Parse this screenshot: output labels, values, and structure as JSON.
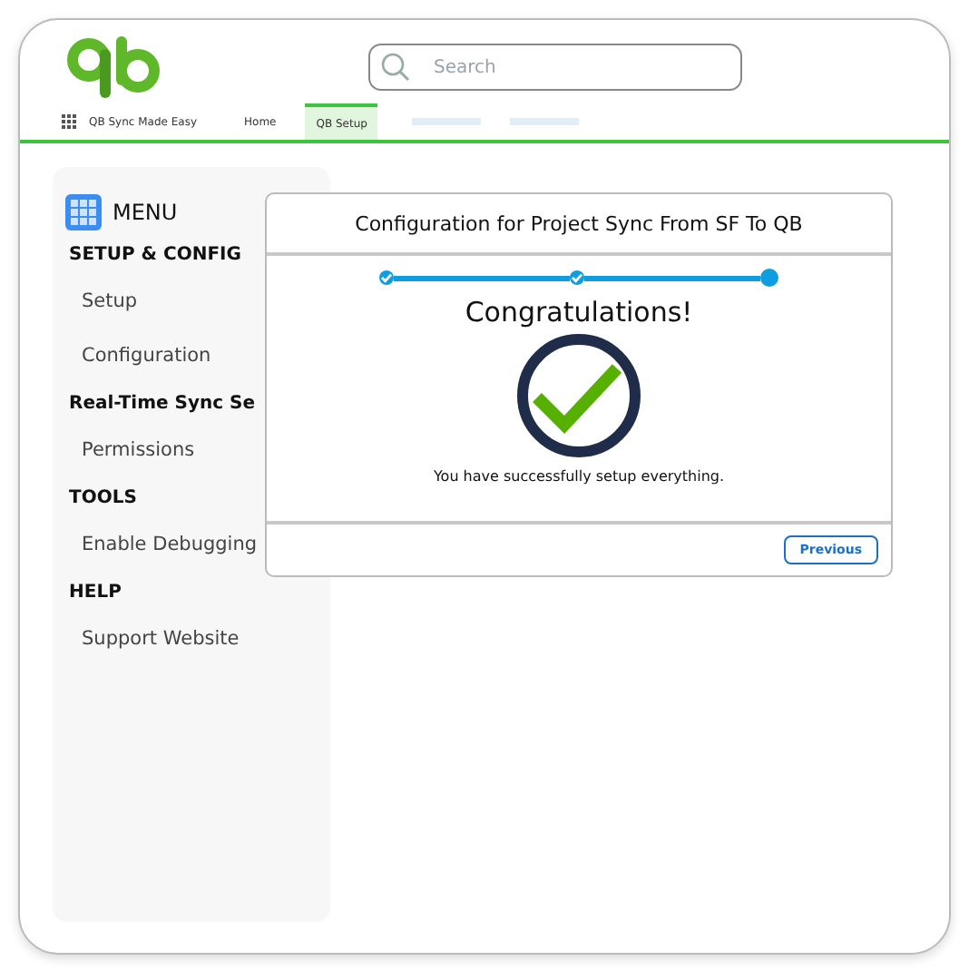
{
  "header": {
    "search": {
      "placeholder": "Search"
    }
  },
  "nav": [
    {
      "kind": "app",
      "label": "QB Sync Made Easy"
    },
    {
      "kind": "tab",
      "label": "Home",
      "selected": false
    },
    {
      "kind": "tab",
      "label": "QB Setup",
      "selected": true
    },
    {
      "kind": "skeleton"
    },
    {
      "kind": "skeleton"
    }
  ],
  "sidebar": {
    "title": "MENU",
    "items": [
      {
        "kind": "heading",
        "label": "SETUP & CONFIG"
      },
      {
        "kind": "link",
        "label": "Setup"
      },
      {
        "kind": "link",
        "label": "Configuration"
      },
      {
        "kind": "heading",
        "label": "Real-Time Sync Se"
      },
      {
        "kind": "link",
        "label": "Permissions"
      },
      {
        "kind": "heading",
        "label": "TOOLS"
      },
      {
        "kind": "link",
        "label": "Enable Debugging"
      },
      {
        "kind": "heading",
        "label": "HELP"
      },
      {
        "kind": "link",
        "label": "Support Website"
      }
    ]
  },
  "dialog": {
    "title": "Configuration for Project Sync From SF To QB",
    "steps": [
      {
        "done": true
      },
      {
        "done": true
      },
      {
        "done": false
      }
    ],
    "heading": "Congratulations!",
    "message": "You have successfully setup everything.",
    "buttons": [
      "Previous"
    ]
  }
}
